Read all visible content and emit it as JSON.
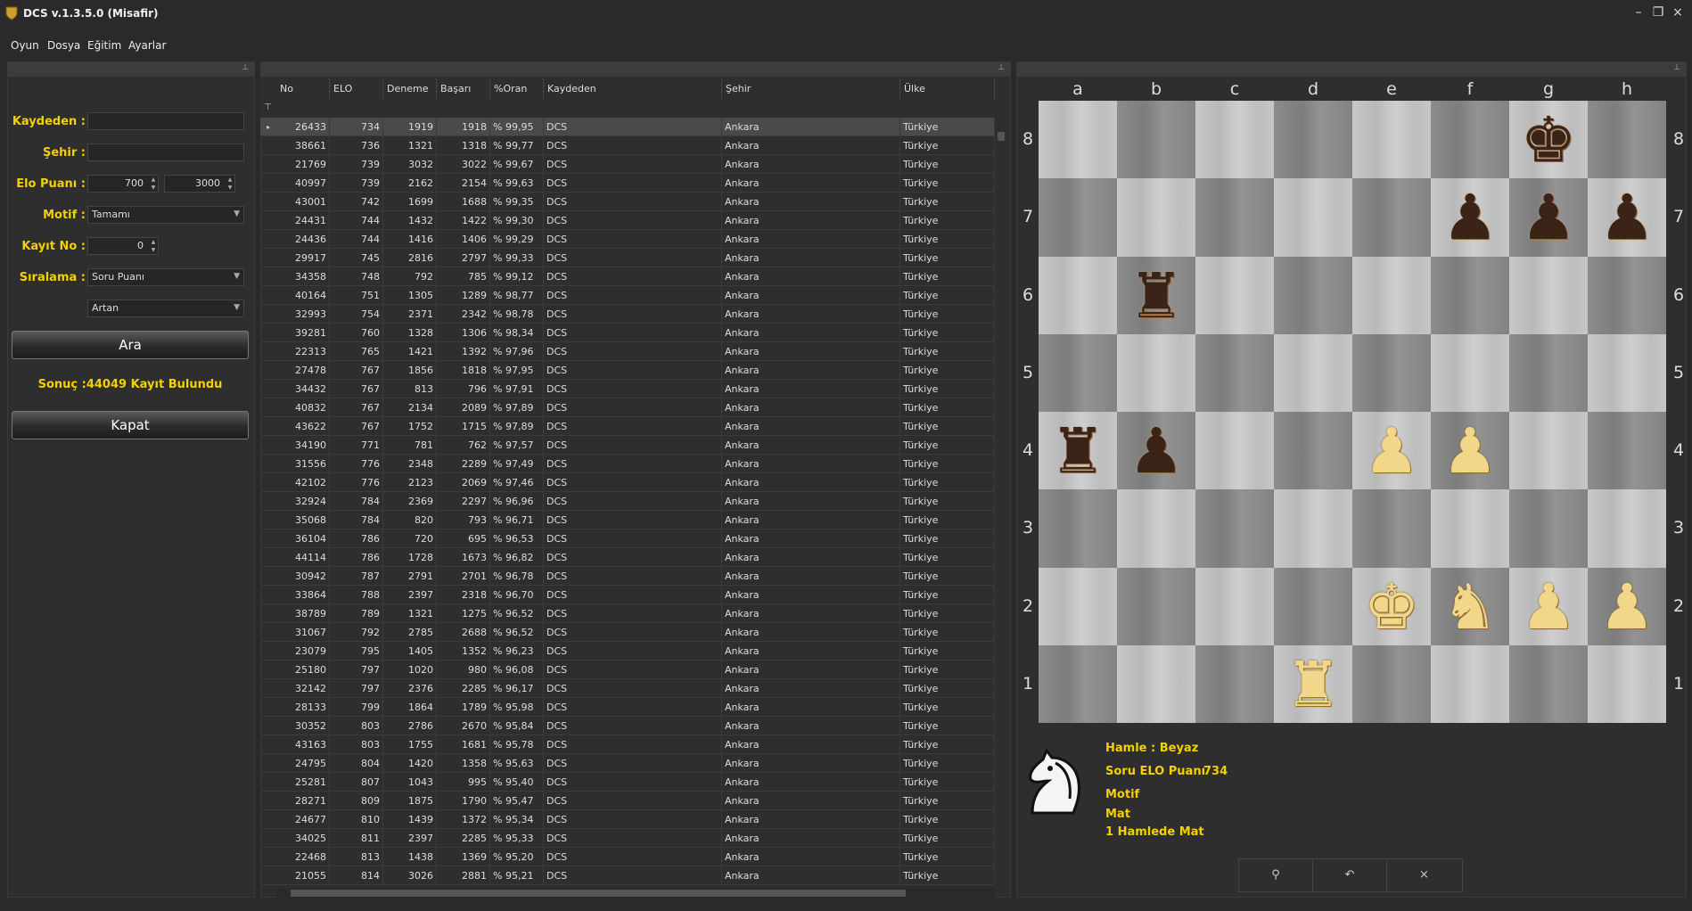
{
  "window": {
    "title": "DCS v.1.3.5.0 (Misafir)"
  },
  "menu": [
    "Oyun",
    "Dosya",
    "Eğitim",
    "Ayarlar"
  ],
  "form": {
    "kaydeden_label": "Kaydeden :",
    "kaydeden_value": "",
    "sehir_label": "Şehir :",
    "sehir_value": "",
    "elo_label": "Elo Puanı :",
    "elo_min": "700",
    "elo_max": "3000",
    "motif_label": "Motif :",
    "motif_value": "Tamamı",
    "kayit_label": "Kayıt No :",
    "kayit_value": "0",
    "siralama_label": "Sıralama :",
    "siralama_value": "Soru Puanı",
    "order_value": "Artan",
    "search_button": "Ara",
    "result_text": "Sonuç :44049 Kayıt Bulundu",
    "close_button": "Kapat"
  },
  "table": {
    "columns": [
      "No",
      "ELO",
      "Deneme",
      "Başarı",
      "%Oran",
      "Kaydeden",
      "Şehir",
      "Ülke"
    ],
    "rows": [
      [
        "26433",
        "734",
        "1919",
        "1918",
        "% 99,95",
        "DCS",
        "Ankara",
        "Türkiye"
      ],
      [
        "38661",
        "736",
        "1321",
        "1318",
        "% 99,77",
        "DCS",
        "Ankara",
        "Türkiye"
      ],
      [
        "21769",
        "739",
        "3032",
        "3022",
        "% 99,67",
        "DCS",
        "Ankara",
        "Türkiye"
      ],
      [
        "40997",
        "739",
        "2162",
        "2154",
        "% 99,63",
        "DCS",
        "Ankara",
        "Türkiye"
      ],
      [
        "43001",
        "742",
        "1699",
        "1688",
        "% 99,35",
        "DCS",
        "Ankara",
        "Türkiye"
      ],
      [
        "24431",
        "744",
        "1432",
        "1422",
        "% 99,30",
        "DCS",
        "Ankara",
        "Türkiye"
      ],
      [
        "24436",
        "744",
        "1416",
        "1406",
        "% 99,29",
        "DCS",
        "Ankara",
        "Türkiye"
      ],
      [
        "29917",
        "745",
        "2816",
        "2797",
        "% 99,33",
        "DCS",
        "Ankara",
        "Türkiye"
      ],
      [
        "34358",
        "748",
        "792",
        "785",
        "% 99,12",
        "DCS",
        "Ankara",
        "Türkiye"
      ],
      [
        "40164",
        "751",
        "1305",
        "1289",
        "% 98,77",
        "DCS",
        "Ankara",
        "Türkiye"
      ],
      [
        "32993",
        "754",
        "2371",
        "2342",
        "% 98,78",
        "DCS",
        "Ankara",
        "Türkiye"
      ],
      [
        "39281",
        "760",
        "1328",
        "1306",
        "% 98,34",
        "DCS",
        "Ankara",
        "Türkiye"
      ],
      [
        "22313",
        "765",
        "1421",
        "1392",
        "% 97,96",
        "DCS",
        "Ankara",
        "Türkiye"
      ],
      [
        "27478",
        "767",
        "1856",
        "1818",
        "% 97,95",
        "DCS",
        "Ankara",
        "Türkiye"
      ],
      [
        "34432",
        "767",
        "813",
        "796",
        "% 97,91",
        "DCS",
        "Ankara",
        "Türkiye"
      ],
      [
        "40832",
        "767",
        "2134",
        "2089",
        "% 97,89",
        "DCS",
        "Ankara",
        "Türkiye"
      ],
      [
        "43622",
        "767",
        "1752",
        "1715",
        "% 97,89",
        "DCS",
        "Ankara",
        "Türkiye"
      ],
      [
        "34190",
        "771",
        "781",
        "762",
        "% 97,57",
        "DCS",
        "Ankara",
        "Türkiye"
      ],
      [
        "31556",
        "776",
        "2348",
        "2289",
        "% 97,49",
        "DCS",
        "Ankara",
        "Türkiye"
      ],
      [
        "42102",
        "776",
        "2123",
        "2069",
        "% 97,46",
        "DCS",
        "Ankara",
        "Türkiye"
      ],
      [
        "32924",
        "784",
        "2369",
        "2297",
        "% 96,96",
        "DCS",
        "Ankara",
        "Türkiye"
      ],
      [
        "35068",
        "784",
        "820",
        "793",
        "% 96,71",
        "DCS",
        "Ankara",
        "Türkiye"
      ],
      [
        "36104",
        "786",
        "720",
        "695",
        "% 96,53",
        "DCS",
        "Ankara",
        "Türkiye"
      ],
      [
        "44114",
        "786",
        "1728",
        "1673",
        "% 96,82",
        "DCS",
        "Ankara",
        "Türkiye"
      ],
      [
        "30942",
        "787",
        "2791",
        "2701",
        "% 96,78",
        "DCS",
        "Ankara",
        "Türkiye"
      ],
      [
        "33864",
        "788",
        "2397",
        "2318",
        "% 96,70",
        "DCS",
        "Ankara",
        "Türkiye"
      ],
      [
        "38789",
        "789",
        "1321",
        "1275",
        "% 96,52",
        "DCS",
        "Ankara",
        "Türkiye"
      ],
      [
        "31067",
        "792",
        "2785",
        "2688",
        "% 96,52",
        "DCS",
        "Ankara",
        "Türkiye"
      ],
      [
        "23079",
        "795",
        "1405",
        "1352",
        "% 96,23",
        "DCS",
        "Ankara",
        "Türkiye"
      ],
      [
        "25180",
        "797",
        "1020",
        "980",
        "% 96,08",
        "DCS",
        "Ankara",
        "Türkiye"
      ],
      [
        "32142",
        "797",
        "2376",
        "2285",
        "% 96,17",
        "DCS",
        "Ankara",
        "Türkiye"
      ],
      [
        "28133",
        "799",
        "1864",
        "1789",
        "% 95,98",
        "DCS",
        "Ankara",
        "Türkiye"
      ],
      [
        "30352",
        "803",
        "2786",
        "2670",
        "% 95,84",
        "DCS",
        "Ankara",
        "Türkiye"
      ],
      [
        "43163",
        "803",
        "1755",
        "1681",
        "% 95,78",
        "DCS",
        "Ankara",
        "Türkiye"
      ],
      [
        "24795",
        "804",
        "1420",
        "1358",
        "% 95,63",
        "DCS",
        "Ankara",
        "Türkiye"
      ],
      [
        "25281",
        "807",
        "1043",
        "995",
        "% 95,40",
        "DCS",
        "Ankara",
        "Türkiye"
      ],
      [
        "28271",
        "809",
        "1875",
        "1790",
        "% 95,47",
        "DCS",
        "Ankara",
        "Türkiye"
      ],
      [
        "24677",
        "810",
        "1439",
        "1372",
        "% 95,34",
        "DCS",
        "Ankara",
        "Türkiye"
      ],
      [
        "34025",
        "811",
        "2397",
        "2285",
        "% 95,33",
        "DCS",
        "Ankara",
        "Türkiye"
      ],
      [
        "22468",
        "813",
        "1438",
        "1369",
        "% 95,20",
        "DCS",
        "Ankara",
        "Türkiye"
      ],
      [
        "21055",
        "814",
        "3026",
        "2881",
        "% 95,21",
        "DCS",
        "Ankara",
        "Türkiye"
      ]
    ]
  },
  "board": {
    "files": [
      "a",
      "b",
      "c",
      "d",
      "e",
      "f",
      "g",
      "h"
    ],
    "ranks": [
      "8",
      "7",
      "6",
      "5",
      "4",
      "3",
      "2",
      "1"
    ],
    "pieces": [
      {
        "sq": "g8",
        "piece": "king",
        "color": "black"
      },
      {
        "sq": "f7",
        "piece": "pawn",
        "color": "black"
      },
      {
        "sq": "g7",
        "piece": "pawn",
        "color": "black"
      },
      {
        "sq": "h7",
        "piece": "pawn",
        "color": "black"
      },
      {
        "sq": "b6",
        "piece": "rook",
        "color": "black"
      },
      {
        "sq": "a4",
        "piece": "rook",
        "color": "black"
      },
      {
        "sq": "b4",
        "piece": "pawn",
        "color": "black"
      },
      {
        "sq": "e4",
        "piece": "pawn",
        "color": "white"
      },
      {
        "sq": "f4",
        "piece": "pawn",
        "color": "white"
      },
      {
        "sq": "e2",
        "piece": "king",
        "color": "white"
      },
      {
        "sq": "f2",
        "piece": "knight",
        "color": "white"
      },
      {
        "sq": "g2",
        "piece": "pawn",
        "color": "white"
      },
      {
        "sq": "h2",
        "piece": "pawn",
        "color": "white"
      },
      {
        "sq": "d1",
        "piece": "rook",
        "color": "white"
      }
    ]
  },
  "info": {
    "hamle": "Hamle : Beyaz",
    "soru_label": "Soru ELO Puanı",
    "soru_value": "734",
    "motif_label": "Motif",
    "motif_value": "Mat",
    "detail": "1 Hamlede Mat"
  },
  "toolbar": {
    "icons": [
      "search-icon",
      "undo-icon",
      "close-icon"
    ]
  },
  "colors": {
    "accent": "#f5d000",
    "background": "#2a2a2a"
  }
}
